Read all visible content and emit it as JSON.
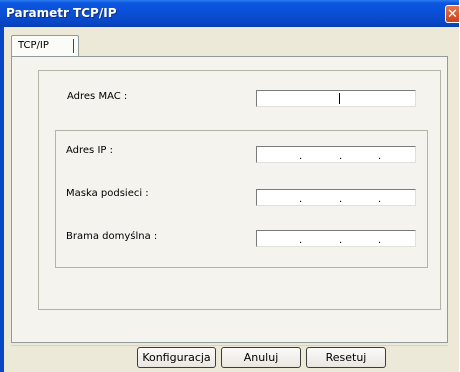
{
  "window": {
    "title": "Parametr TCP/IP"
  },
  "tabs": [
    {
      "label": "TCP/IP"
    }
  ],
  "fields": {
    "mac": {
      "label": "Adres MAC :",
      "value": ""
    },
    "ip": {
      "label": "Adres IP :",
      "separators": [
        ".",
        ".",
        "."
      ]
    },
    "mask": {
      "label": "Maska podsieci :",
      "separators": [
        ".",
        ".",
        "."
      ]
    },
    "gateway": {
      "label": "Brama domyślna :",
      "separators": [
        ".",
        ".",
        "."
      ]
    }
  },
  "buttons": {
    "configure": "Konfiguracja",
    "cancel": "Anuluj",
    "reset": "Resetuj"
  },
  "colors": {
    "titlebar": "#0a4fd6",
    "close": "#d6562b",
    "window_bg": "#ece9d8"
  }
}
